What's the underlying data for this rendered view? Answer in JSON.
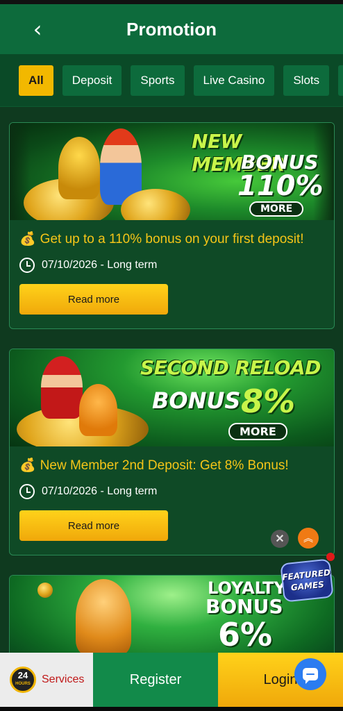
{
  "header": {
    "title": "Promotion",
    "back_icon": "chevron-left-icon"
  },
  "tabs": [
    {
      "label": "All",
      "active": true
    },
    {
      "label": "Deposit",
      "active": false
    },
    {
      "label": "Sports",
      "active": false
    },
    {
      "label": "Live Casino",
      "active": false
    },
    {
      "label": "Slots",
      "active": false
    },
    {
      "label": "",
      "active": false
    }
  ],
  "promotions": [
    {
      "banner": {
        "line1": "NEW MEMBER",
        "line2": "BONUS",
        "line3": "110%",
        "more": "MORE"
      },
      "description": "Get up to a 110% bonus on your first deposit!",
      "date": "07/10/2026 - Long term",
      "button": "Read more"
    },
    {
      "banner": {
        "line1": "SECOND RELOAD",
        "line2": "BONUS",
        "line3": "8%",
        "more": "MORE"
      },
      "description": "New Member 2nd Deposit: Get 8% Bonus!",
      "date": "07/10/2026 - Long term",
      "button": "Read more"
    },
    {
      "banner": {
        "line1": "LOYALTY",
        "line2": "BONUS",
        "line3": "6%"
      }
    }
  ],
  "floating": {
    "featured_line1": "FEATURED",
    "featured_line2": "GAMES"
  },
  "bottom_bar": {
    "clock_number": "24",
    "clock_sub": "HOURS",
    "services": "Services",
    "register": "Register",
    "login": "Login"
  },
  "colors": {
    "header_bg": "#0d6b3c",
    "accent_gold": "#f2b800",
    "desc_text": "#f5c518",
    "register_bg": "#128a4a"
  }
}
